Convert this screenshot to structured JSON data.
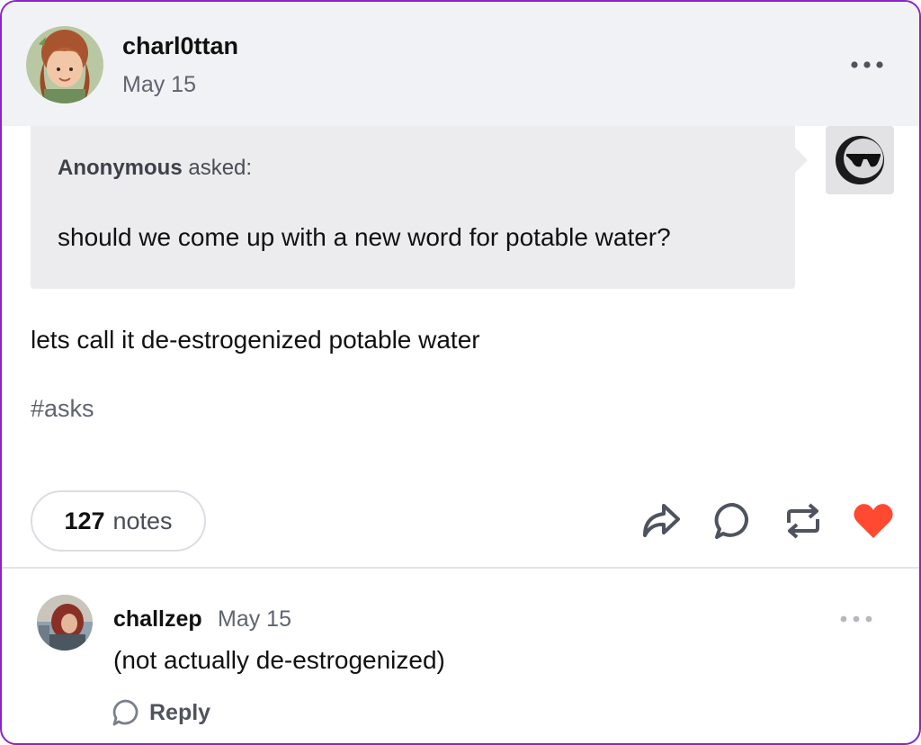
{
  "post": {
    "author": "charl0ttan",
    "date": "May 15",
    "ask": {
      "asker": "Anonymous",
      "asked_label": "asked:",
      "question": "should we come up with a new word for potable water?"
    },
    "answer": "lets call it de-estrogenized potable water",
    "tags": [
      "#asks"
    ],
    "notes": {
      "count": "127",
      "label": "notes"
    },
    "actions": [
      "share-icon",
      "reply-icon",
      "reblog-icon",
      "like-icon"
    ],
    "like_color": "#ff4930"
  },
  "comment": {
    "author": "challzep",
    "date": "May 15",
    "text": "(not actually de-estrogenized)",
    "reply_label": "Reply"
  },
  "theme": {
    "frame_border": "#8a24c7",
    "header_bg": "#f1f2f5",
    "ask_bg": "#ececef",
    "muted_text": "#5f6470"
  }
}
